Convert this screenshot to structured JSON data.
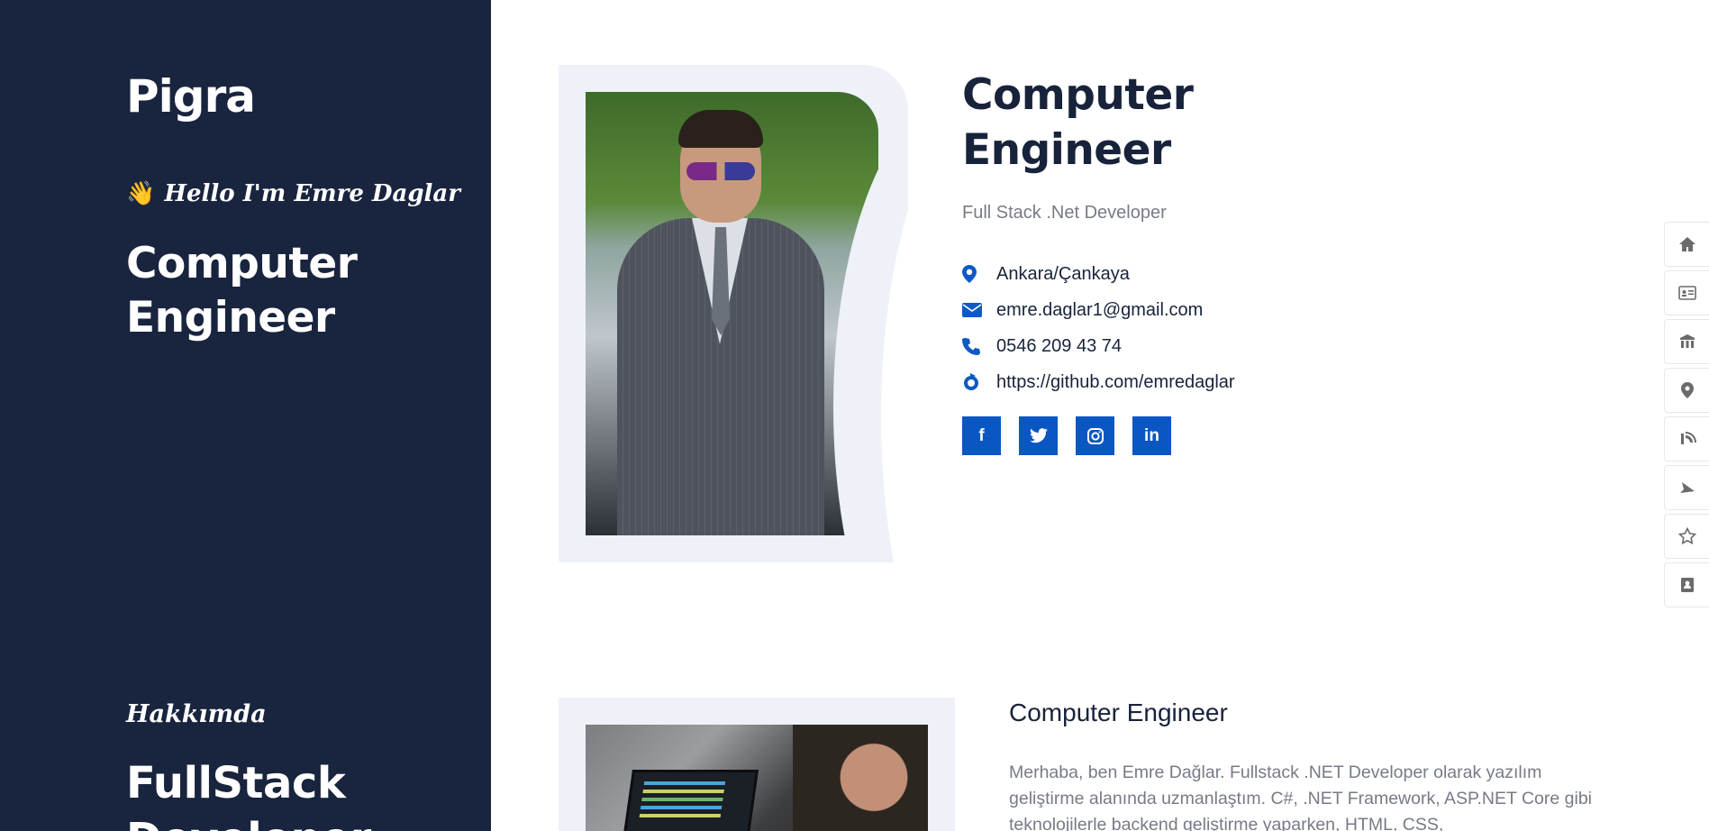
{
  "sidebar": {
    "brand": "Pigra",
    "wave": "👋",
    "hello": "Hello I'm Emre Daglar",
    "title": "Computer Engineer",
    "section_label": "Hakkımda",
    "section_title": "FullStack Developer"
  },
  "profile": {
    "title_line1": "Computer",
    "title_line2": "Engineer",
    "role": "Full Stack .Net Developer",
    "contacts": [
      {
        "icon": "location-pin-icon",
        "text": "Ankara/Çankaya"
      },
      {
        "icon": "envelope-icon",
        "text": "emre.daglar1@gmail.com"
      },
      {
        "icon": "phone-icon",
        "text": "0546 209 43 74"
      },
      {
        "icon": "refresh-link-icon",
        "text": "https://github.com/emredaglar"
      }
    ],
    "socials": [
      {
        "icon": "facebook-icon",
        "glyph": "f"
      },
      {
        "icon": "twitter-icon",
        "glyph": "t"
      },
      {
        "icon": "instagram-icon",
        "glyph": "◎"
      },
      {
        "icon": "linkedin-icon",
        "glyph": "in"
      }
    ]
  },
  "right_nav": [
    "home-icon",
    "id-card-icon",
    "school-icon",
    "location-icon",
    "blog-icon",
    "paper-plane-icon",
    "star-icon",
    "contact-book-icon"
  ],
  "about": {
    "title": "Computer Engineer",
    "text": "Merhaba, ben Emre Dağlar. Fullstack .NET Developer olarak yazılım geliştirme alanında uzmanlaştım. C#, .NET Framework, ASP.NET Core gibi teknolojilerle backend geliştirme yaparken, HTML, CSS,"
  },
  "colors": {
    "sidebar_bg": "#19243e",
    "accent": "#0a56c2",
    "frame_bg": "#eef2f8"
  }
}
